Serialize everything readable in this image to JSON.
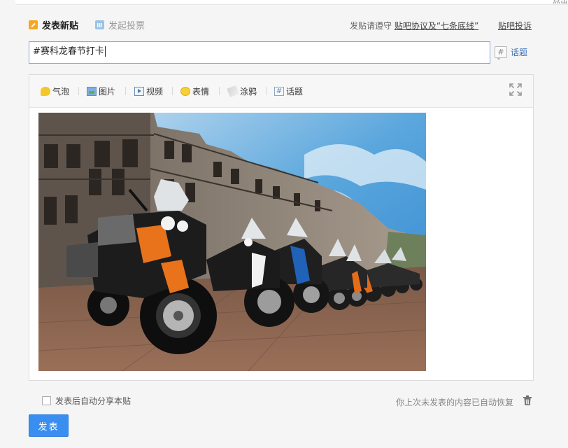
{
  "header": {
    "tab_new_post": "发表新贴",
    "tab_vote": "发起投票",
    "rules_prefix": "发贴请遵守",
    "rules_link": "贴吧协议及“七条底线”",
    "complain_link": "贴吧投诉",
    "top_edge_text": "点击"
  },
  "title": {
    "value": "#赛科龙春节打卡"
  },
  "topic_side": {
    "hash_symbol": "#",
    "label": "话题"
  },
  "toolbar": {
    "items": [
      {
        "label": "气泡",
        "icon": "bubble-icon"
      },
      {
        "label": "图片",
        "icon": "image-icon"
      },
      {
        "label": "视频",
        "icon": "video-icon"
      },
      {
        "label": "表情",
        "icon": "emoji-icon"
      },
      {
        "label": "涂鸦",
        "icon": "doodle-icon"
      },
      {
        "label": "话题",
        "icon": "hash-icon"
      }
    ],
    "hash_symbol": "#"
  },
  "footer": {
    "share_label": "发表后自动分享本贴",
    "share_checked": false,
    "restore_text": "你上次未发表的内容已自动恢复",
    "submit_label": "发表"
  },
  "colors": {
    "accent": "#3a8ef0",
    "link": "#3a6fb5",
    "input_border": "#7ea8dd"
  }
}
